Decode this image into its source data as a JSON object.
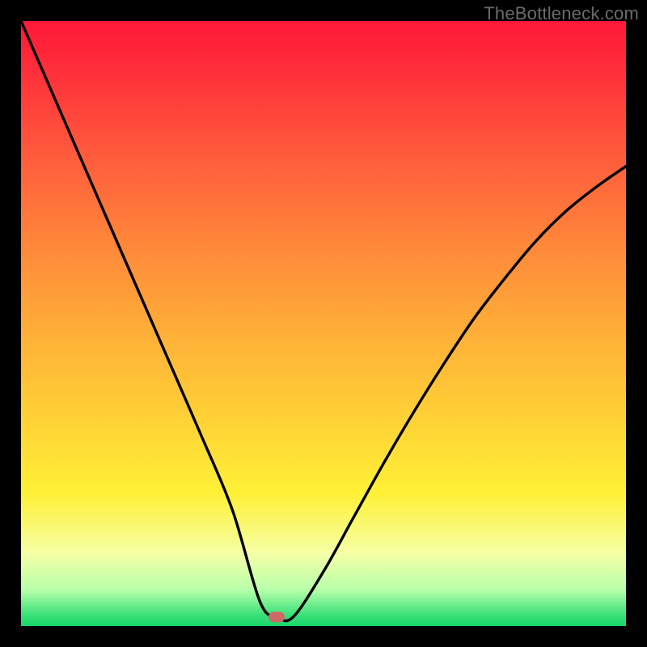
{
  "watermark": "TheBottleneck.com",
  "marker": {
    "x_frac": 0.423,
    "y_frac": 0.985
  },
  "chart_data": {
    "type": "line",
    "title": "",
    "xlabel": "",
    "ylabel": "",
    "xlim": [
      0,
      1
    ],
    "ylim": [
      0,
      1
    ],
    "series": [
      {
        "name": "bottleneck-curve",
        "x": [
          0.0,
          0.05,
          0.1,
          0.15,
          0.2,
          0.25,
          0.3,
          0.35,
          0.395,
          0.423,
          0.45,
          0.5,
          0.55,
          0.6,
          0.65,
          0.7,
          0.75,
          0.8,
          0.85,
          0.9,
          0.95,
          1.0
        ],
        "y": [
          1.0,
          0.885,
          0.77,
          0.655,
          0.54,
          0.425,
          0.31,
          0.19,
          0.04,
          0.015,
          0.015,
          0.09,
          0.18,
          0.27,
          0.355,
          0.435,
          0.51,
          0.575,
          0.635,
          0.685,
          0.725,
          0.76
        ]
      }
    ],
    "annotations": [
      {
        "name": "optimal-marker",
        "x": 0.423,
        "y": 0.015
      }
    ]
  }
}
